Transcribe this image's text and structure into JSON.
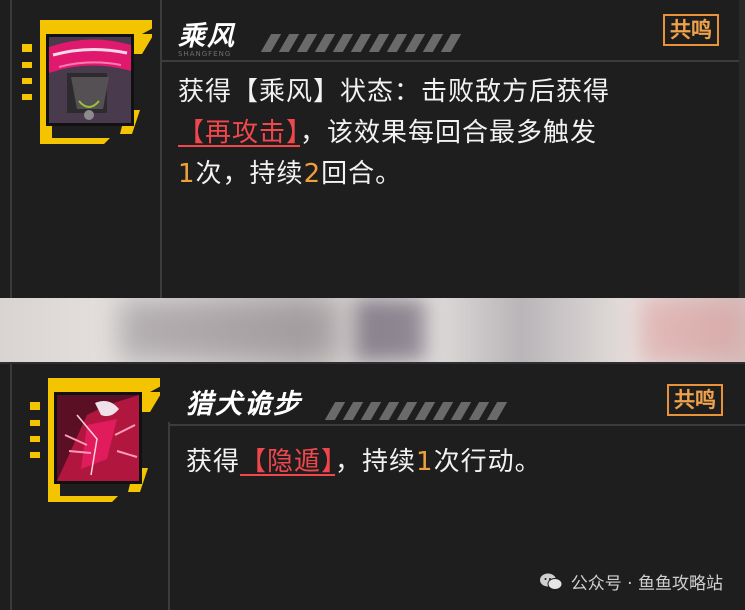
{
  "cards": [
    {
      "title": "乘风",
      "subtitle": "SHANGFENG",
      "badge": "共鸣",
      "desc": {
        "p1": "获得【乘风】状态：击败敌方后获得",
        "kw": "【再攻击】",
        "p2": "，该效果每回合最多触发",
        "n1": "1",
        "p3": "次，持续",
        "n2": "2",
        "p4": "回合。"
      }
    },
    {
      "title": "猎犬诡步",
      "badge": "共鸣",
      "desc": {
        "p1": "获得",
        "kw": "【隐遁】",
        "p2": "，持续",
        "n1": "1",
        "p3": "次行动。"
      }
    }
  ],
  "watermark": "公众号 · 鱼鱼攻略站",
  "colors": {
    "keyword": "#f0474c",
    "number": "#f0a03a",
    "badge": "#e8923a",
    "frame": "#f5c400"
  }
}
